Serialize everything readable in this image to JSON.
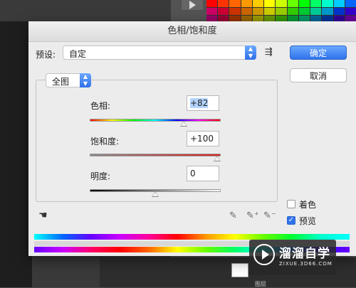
{
  "dialog": {
    "title": "色相/饱和度",
    "preset_label": "预设:",
    "preset_value": "自定",
    "ok_label": "确定",
    "cancel_label": "取消",
    "channel_value": "全图",
    "hue": {
      "label": "色相:",
      "value": "+82",
      "slider_fraction": 0.73
    },
    "saturation": {
      "label": "饱和度:",
      "value": "+100",
      "slider_fraction": 1.0
    },
    "lightness": {
      "label": "明度:",
      "value": "0",
      "slider_fraction": 0.5
    },
    "colorize_label": "着色",
    "colorize_checked": false,
    "preview_label": "预览",
    "preview_checked": true
  },
  "watermark": {
    "name": "溜溜自学",
    "url": "ZIXUE.3D66.COM"
  },
  "background": {
    "layer_label": "图层"
  },
  "colors": {
    "accent": "#2f73ea",
    "dialog_bg": "#ececec",
    "app_bg": "#535353"
  }
}
